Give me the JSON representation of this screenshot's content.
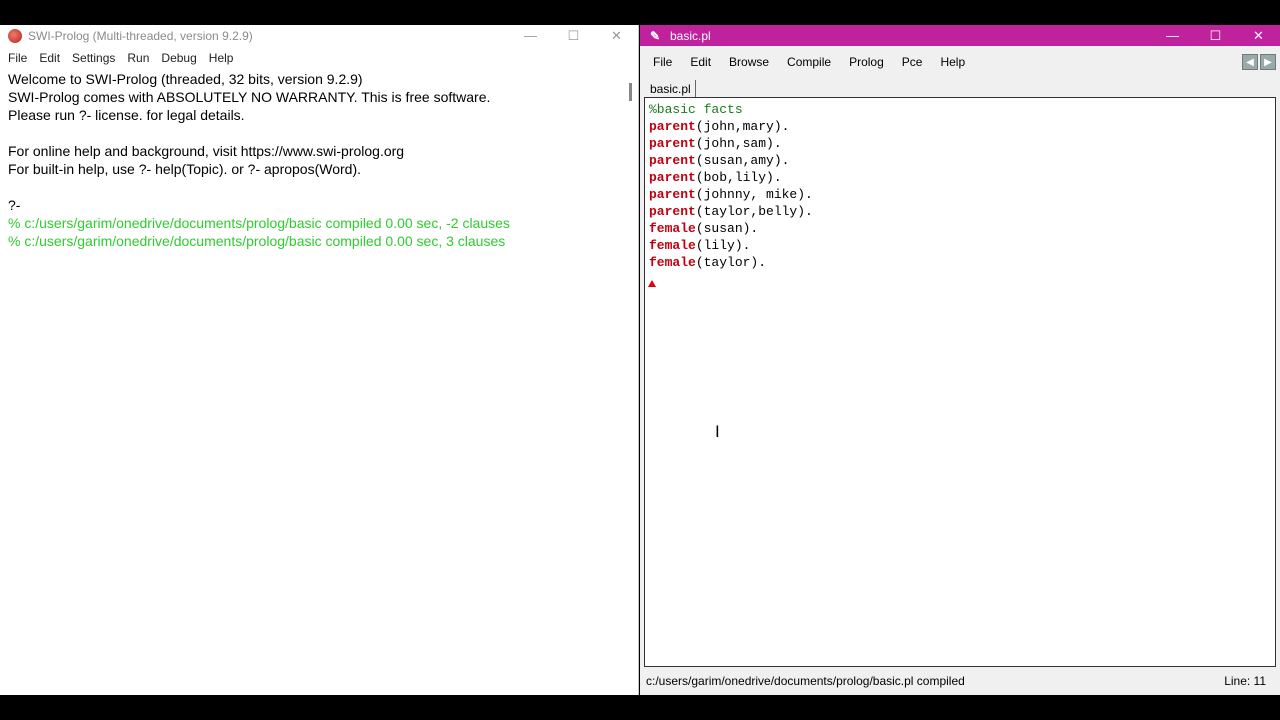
{
  "console": {
    "title": "SWI-Prolog (Multi-threaded, version 9.2.9)",
    "menu": [
      "File",
      "Edit",
      "Settings",
      "Run",
      "Debug",
      "Help"
    ],
    "lines": [
      {
        "text": "Welcome to SWI-Prolog (threaded, 32 bits, version 9.2.9)",
        "color": "black"
      },
      {
        "text": "SWI-Prolog comes with ABSOLUTELY NO WARRANTY. This is free software.",
        "color": "black"
      },
      {
        "text": "Please run ?- license. for legal details.",
        "color": "black"
      },
      {
        "text": "",
        "color": "black"
      },
      {
        "text": "For online help and background, visit https://www.swi-prolog.org",
        "color": "black"
      },
      {
        "text": "For built-in help, use ?- help(Topic). or ?- apropos(Word).",
        "color": "black"
      },
      {
        "text": "",
        "color": "black"
      },
      {
        "text": "?-",
        "color": "black"
      },
      {
        "text": "% c:/users/garim/onedrive/documents/prolog/basic compiled 0.00 sec, -2 clauses",
        "color": "green"
      },
      {
        "text": "% c:/users/garim/onedrive/documents/prolog/basic compiled 0.00 sec, 3 clauses",
        "color": "green"
      }
    ]
  },
  "editor": {
    "title": "basic.pl",
    "menu": [
      "File",
      "Edit",
      "Browse",
      "Compile",
      "Prolog",
      "Pce",
      "Help"
    ],
    "tab": "basic.pl",
    "code": [
      {
        "comment": "%basic facts"
      },
      {
        "kw": "parent",
        "args": "(john,mary)."
      },
      {
        "kw": "parent",
        "args": "(john,sam)."
      },
      {
        "kw": "parent",
        "args": "(susan,amy)."
      },
      {
        "kw": "parent",
        "args": "(bob,lily)."
      },
      {
        "kw": "parent",
        "args": "(johnny, mike)."
      },
      {
        "kw": "parent",
        "args": "(taylor,belly)."
      },
      {
        "kw": "female",
        "args": "(susan)."
      },
      {
        "kw": "female",
        "args": "(lily)."
      },
      {
        "kw": "female",
        "args": "(taylor)."
      }
    ],
    "status_message": "c:/users/garim/onedrive/documents/prolog/basic.pl compiled",
    "status_line": "Line: 11"
  },
  "window_controls": {
    "minimize": "—",
    "maximize": "☐",
    "close": "✕"
  },
  "icons": {
    "console_app": "swi-prolog-owl-icon",
    "editor_app": "pceemacs-icon",
    "nav_back": "arrow-left-icon",
    "nav_forward": "arrow-right-icon"
  },
  "colors": {
    "editor_titlebar": "#c0219c",
    "keyword": "#c00010",
    "comment": "#1a7a1a",
    "console_green": "#2ecc2e"
  }
}
